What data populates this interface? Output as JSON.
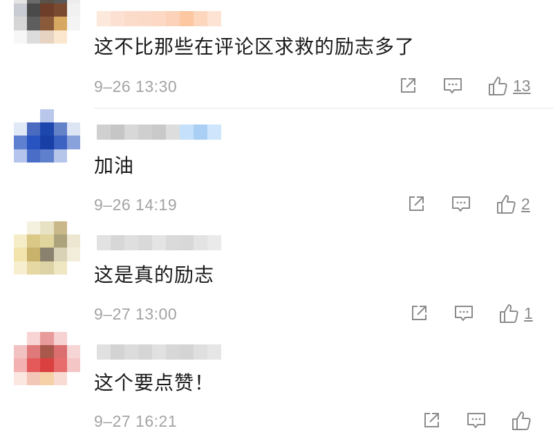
{
  "comments": [
    {
      "text": "这不比那些在评论区求救的励志多了",
      "time": "9–26 13:30",
      "like_count": "13",
      "colors": [
        "#fde8dc",
        "#fce1d2",
        "#fbdccb",
        "#fcdac8",
        "#fdd9c5",
        "#fcd2b8",
        "#fcc7a1",
        "#fcd7bd",
        "#fde3d3"
      ],
      "avatar": [
        "#e4e4e4",
        "#6b6b6b",
        "#5a5248",
        "#595959",
        "#ececec",
        "#c9cdd3",
        "#4a4a4a",
        "#6e3e2a",
        "#7a4a30",
        "#f1f1f1",
        "#d6d6d6",
        "#5e5e5e",
        "#8a5a3a",
        "#d6a860",
        "#f4f4f4",
        "#f7f7f7",
        "#dcdcdc",
        "#e7d3c2",
        "#fbe7d0",
        "#ffffff",
        "#ffffff",
        "#ffffff",
        "#ffffff",
        "#ffffff",
        "#ffffff"
      ]
    },
    {
      "text": "加油",
      "time": "9–26 14:19",
      "like_count": "2",
      "colors": [
        "#d0d0d0",
        "#c6c6c6",
        "#d8d8d8",
        "#cfcfcf",
        "#c9c9c9",
        "#dddddd",
        "#c4e0fb",
        "#a9cff5",
        "#cfe5fb"
      ],
      "avatar": [
        "#ffffff",
        "#ffffff",
        "#b9c7ea",
        "#ffffff",
        "#ffffff",
        "#e1e8f6",
        "#4a6bc0",
        "#1d47ad",
        "#6482c8",
        "#dde5f4",
        "#5f7fd0",
        "#2754c0",
        "#183fa6",
        "#3c62c2",
        "#8aa2dc",
        "#b4c4ec",
        "#4a6ec8",
        "#5f80cc",
        "#b5c6ea",
        "#ffffff",
        "#ffffff",
        "#ffffff",
        "#ffffff",
        "#ffffff",
        "#ffffff"
      ]
    },
    {
      "text": "这是真的励志",
      "time": "9–27 13:00",
      "like_count": "1",
      "colors": [
        "#e2e2e2",
        "#d7d7d7",
        "#dfdfdf",
        "#d9d9d9",
        "#e4e4e4",
        "#dadada",
        "#d8d8d8",
        "#e3e3e3",
        "#eaeaea"
      ],
      "avatar": [
        "#ffffff",
        "#f5f1df",
        "#e8e2c4",
        "#c9b98a",
        "#ffffff",
        "#f5ecc8",
        "#d9c886",
        "#e0d59c",
        "#aca27c",
        "#ede7d2",
        "#f2e4ac",
        "#c8b26c",
        "#8a826e",
        "#d9d2b6",
        "#f3eedc",
        "#f7eed0",
        "#e6d8a2",
        "#dcd2a6",
        "#efe6c2",
        "#ffffff",
        "#ffffff",
        "#ffffff",
        "#ffffff",
        "#ffffff",
        "#ffffff"
      ]
    },
    {
      "text": "这个要点赞！",
      "time": "9–27 16:21",
      "like_count": "",
      "colors": [
        "#e0e0e0",
        "#d3d3d3",
        "#dcdcdc",
        "#d5d5d5",
        "#e1e1e1",
        "#d7d7d7",
        "#d4d4d4",
        "#dfdfdf",
        "#e6e6e6"
      ],
      "avatar": [
        "#ffffff",
        "#f8d4d4",
        "#e79b9b",
        "#f6d2d2",
        "#ffffff",
        "#f2c2c2",
        "#e07a7a",
        "#a8594c",
        "#db6e6e",
        "#f6d5d5",
        "#f3b1b1",
        "#e45a5a",
        "#d9403f",
        "#e86c6c",
        "#f4c6c6",
        "#fbe6e0",
        "#f3c7b8",
        "#f6d1a8",
        "#f8dcd4",
        "#ffffff",
        "#ffffff",
        "#ffffff",
        "#ffffff",
        "#ffffff",
        "#ffffff"
      ]
    }
  ],
  "icons": {
    "share": "share-icon",
    "reply": "comment-icon",
    "like": "thumbs-up-icon"
  }
}
